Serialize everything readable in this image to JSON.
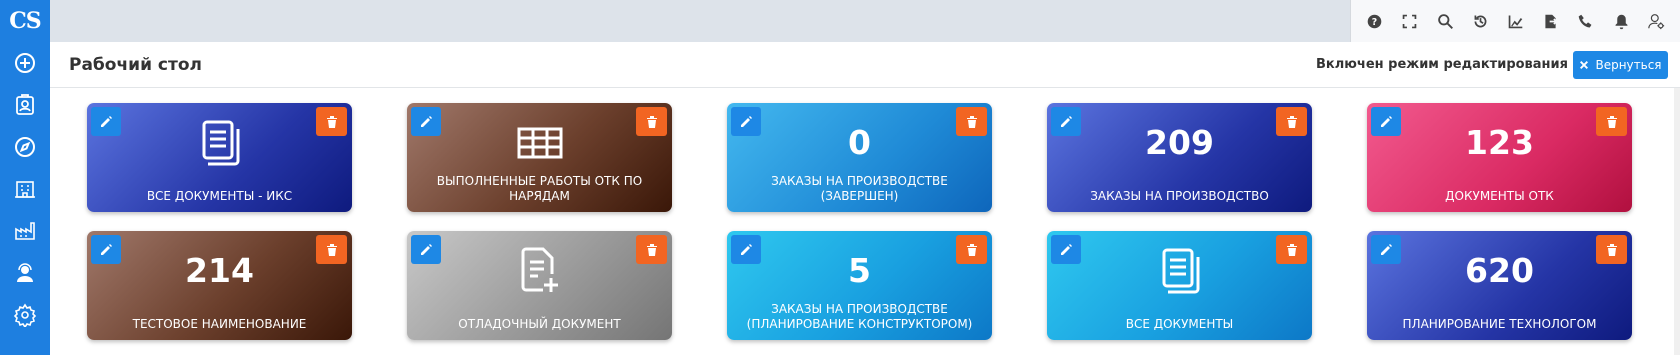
{
  "app": {
    "logo": "CS"
  },
  "sidebar": {
    "items": [
      {
        "icon": "plus-circle-icon"
      },
      {
        "icon": "id-card-icon"
      },
      {
        "icon": "compass-icon"
      },
      {
        "icon": "building-icon"
      },
      {
        "icon": "factory-icon"
      },
      {
        "icon": "support-agent-icon"
      },
      {
        "icon": "settings-gear-icon"
      }
    ]
  },
  "topbar": {
    "tools": [
      "help-icon",
      "fullscreen-icon",
      "search-icon",
      "history-icon",
      "chart-icon",
      "export-icon",
      "phone-icon",
      "bell-icon",
      "user-settings-icon"
    ]
  },
  "header": {
    "title": "Рабочий стол",
    "edit_mode": "Включен режим редактирования",
    "back_label": "Вернуться"
  },
  "tiles": [
    {
      "label": "ВСЕ ДОКУМЕНТЫ - ИКС",
      "icon": "documents-icon",
      "value": ""
    },
    {
      "label": "ВЫПОЛНЕННЫЕ РАБОТЫ ОТК ПО НАРЯДАМ",
      "icon": "table-icon",
      "value": ""
    },
    {
      "label": "ЗАКАЗЫ НА ПРОИЗВОДСТВЕ (ЗАВЕРШЕН)",
      "icon": "",
      "value": "0"
    },
    {
      "label": "ЗАКАЗЫ НА ПРОИЗВОДСТВО",
      "icon": "",
      "value": "209"
    },
    {
      "label": "ДОКУМЕНТЫ ОТК",
      "icon": "",
      "value": "123"
    },
    {
      "label": "ТЕСТОВОЕ НАИМЕНОВАНИЕ",
      "icon": "",
      "value": "214"
    },
    {
      "label": "ОТЛАДОЧНЫЙ ДОКУМЕНТ",
      "icon": "add-document-icon",
      "value": ""
    },
    {
      "label": "ЗАКАЗЫ НА ПРОИЗВОДСТВЕ (ПЛАНИРОВАНИЕ КОНСТРУКТОРОМ)",
      "icon": "",
      "value": "5"
    },
    {
      "label": "ВСЕ ДОКУМЕНТЫ",
      "icon": "documents-icon",
      "value": ""
    },
    {
      "label": "ПЛАНИРОВАНИЕ ТЕХНОЛОГОМ",
      "icon": "",
      "value": "620"
    }
  ],
  "colors": {
    "sidebar": "#1e7fe0",
    "edit_button": "#1e88e5",
    "delete_button": "#f26522"
  }
}
